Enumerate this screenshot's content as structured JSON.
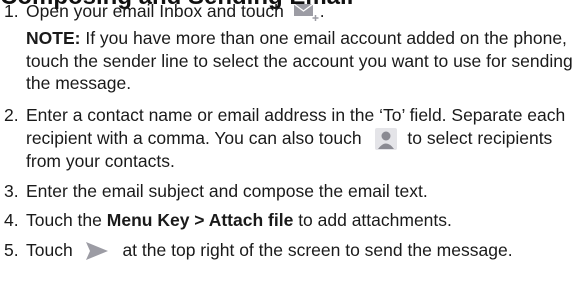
{
  "heading": "Composing and Sending Email",
  "steps": [
    {
      "number": "1.",
      "text_before": "Open your email Inbox and touch",
      "icon": "compose-email-icon",
      "text_after": ".",
      "note_label": "NOTE:",
      "note_text": "If you have more than one email account added on the phone, touch the sender line to select the account you want to use for sending the message."
    },
    {
      "number": "2.",
      "text_before": "Enter a contact name or email address in the ‘To’ field. Separate each recipient with a comma. You can also touch",
      "icon": "contact-person-icon",
      "text_after": "to select recipients from your contacts."
    },
    {
      "number": "3.",
      "text": "Enter the email subject and compose the email text."
    },
    {
      "number": "4.",
      "text_before": "Touch the",
      "bold": "Menu Key > Attach file",
      "text_after": "to add attachments."
    },
    {
      "number": "5.",
      "text_before": "Touch",
      "icon": "send-icon",
      "text_after": "at the top right of the screen to send the message."
    }
  ],
  "colors": {
    "text": "#1a1a1a",
    "icon": "#9c9ca4"
  }
}
